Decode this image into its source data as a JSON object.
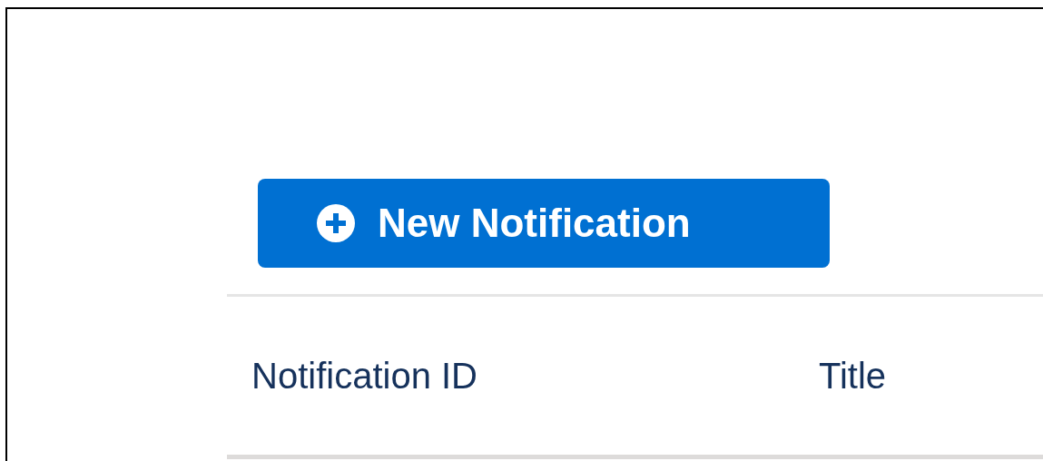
{
  "button": {
    "label": "New Notification"
  },
  "table": {
    "columns": [
      "Notification ID",
      "Title"
    ]
  }
}
